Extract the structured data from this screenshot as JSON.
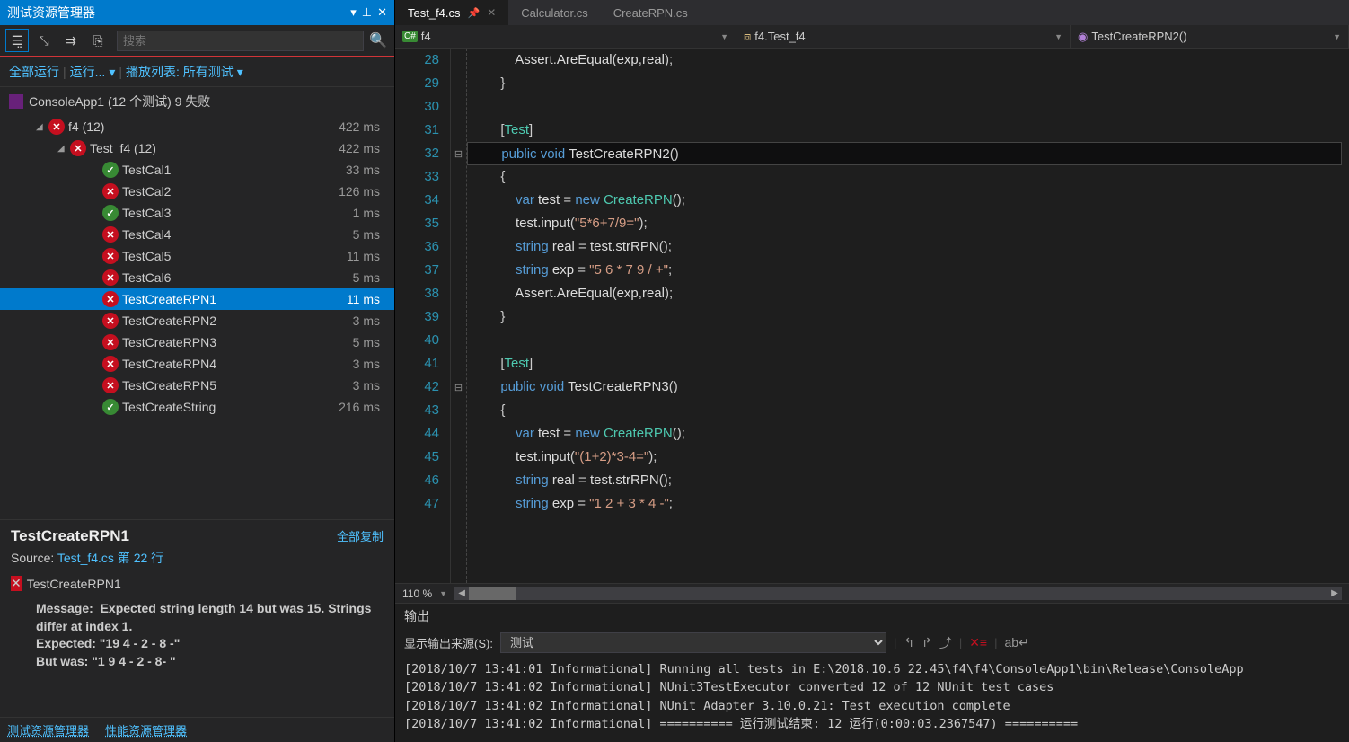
{
  "test_explorer": {
    "title": "测试资源管理器",
    "search_placeholder": "搜索",
    "run_all": "全部运行",
    "run": "运行...",
    "playlist": "播放列表: 所有测试",
    "summary": "ConsoleApp1 (12 个测试) 9 失败",
    "rows": [
      {
        "indent": 40,
        "chevron": "◢",
        "status": "fail",
        "label": "f4 (12)",
        "duration": "422 ms"
      },
      {
        "indent": 64,
        "chevron": "◢",
        "status": "fail",
        "label": "Test_f4 (12)",
        "duration": "422 ms"
      },
      {
        "indent": 100,
        "chevron": "",
        "status": "pass",
        "label": "TestCal1",
        "duration": "33 ms"
      },
      {
        "indent": 100,
        "chevron": "",
        "status": "fail",
        "label": "TestCal2",
        "duration": "126 ms"
      },
      {
        "indent": 100,
        "chevron": "",
        "status": "pass",
        "label": "TestCal3",
        "duration": "1 ms"
      },
      {
        "indent": 100,
        "chevron": "",
        "status": "fail",
        "label": "TestCal4",
        "duration": "5 ms"
      },
      {
        "indent": 100,
        "chevron": "",
        "status": "fail",
        "label": "TestCal5",
        "duration": "11 ms"
      },
      {
        "indent": 100,
        "chevron": "",
        "status": "fail",
        "label": "TestCal6",
        "duration": "5 ms"
      },
      {
        "indent": 100,
        "chevron": "",
        "status": "fail",
        "label": "TestCreateRPN1",
        "duration": "11 ms",
        "selected": true
      },
      {
        "indent": 100,
        "chevron": "",
        "status": "fail",
        "label": "TestCreateRPN2",
        "duration": "3 ms"
      },
      {
        "indent": 100,
        "chevron": "",
        "status": "fail",
        "label": "TestCreateRPN3",
        "duration": "5 ms"
      },
      {
        "indent": 100,
        "chevron": "",
        "status": "fail",
        "label": "TestCreateRPN4",
        "duration": "3 ms"
      },
      {
        "indent": 100,
        "chevron": "",
        "status": "fail",
        "label": "TestCreateRPN5",
        "duration": "3 ms"
      },
      {
        "indent": 100,
        "chevron": "",
        "status": "pass",
        "label": "TestCreateString",
        "duration": "216 ms"
      }
    ],
    "detail": {
      "name": "TestCreateRPN1",
      "copy_all": "全部复制",
      "source_label": "Source:",
      "source_link": "Test_f4.cs 第 22 行",
      "fail_name": "TestCreateRPN1",
      "msg_label": "Message:",
      "msg_body": "Expected string length 14 but was 15. Strings differ at index 1.\n  Expected: \"19 4 - 2 - 8 -\"\n  But was:  \"1 9 4 - 2 - 8- \""
    },
    "bottom_tabs": [
      "测试资源管理器",
      "性能资源管理器"
    ]
  },
  "editor": {
    "tabs": [
      {
        "label": "Test_f4.cs",
        "active": true,
        "pinned": true
      },
      {
        "label": "Calculator.cs",
        "active": false
      },
      {
        "label": "CreateRPN.cs",
        "active": false
      }
    ],
    "breadcrumb": {
      "seg1": "f4",
      "seg2": "f4.Test_f4",
      "seg3": "TestCreateRPN2()"
    },
    "zoom": "110 %",
    "lines": [
      {
        "n": 28,
        "html": "            <span class='id'>Assert</span>.<span class='id'>AreEqual</span>(<span class='id'>exp</span>,<span class='id'>real</span>);"
      },
      {
        "n": 29,
        "html": "        }"
      },
      {
        "n": 30,
        "html": ""
      },
      {
        "n": 31,
        "html": "        [<span class='attr'>Test</span>]"
      },
      {
        "n": 32,
        "html": "        <span class='kw'>public</span> <span class='kw'>void</span> <span class='id'>TestCreateRPN2</span>()",
        "hl": true,
        "fold": "⊟"
      },
      {
        "n": 33,
        "html": "        {"
      },
      {
        "n": 34,
        "html": "            <span class='kw'>var</span> <span class='id'>test</span> = <span class='kw'>new</span> <span class='type'>CreateRPN</span>();"
      },
      {
        "n": 35,
        "html": "            <span class='id'>test</span>.<span class='id'>input</span>(<span class='str'>\"5*6+7/9=\"</span>);"
      },
      {
        "n": 36,
        "html": "            <span class='kw'>string</span> <span class='id'>real</span> = <span class='id'>test</span>.<span class='id'>strRPN</span>();"
      },
      {
        "n": 37,
        "html": "            <span class='kw'>string</span> <span class='id'>exp</span> = <span class='str'>\"5 6 * 7 9 / +\"</span>;"
      },
      {
        "n": 38,
        "html": "            <span class='id'>Assert</span>.<span class='id'>AreEqual</span>(<span class='id'>exp</span>,<span class='id'>real</span>);"
      },
      {
        "n": 39,
        "html": "        }"
      },
      {
        "n": 40,
        "html": ""
      },
      {
        "n": 41,
        "html": "        [<span class='attr'>Test</span>]"
      },
      {
        "n": 42,
        "html": "        <span class='kw'>public</span> <span class='kw'>void</span> <span class='id'>TestCreateRPN3</span>()",
        "fold": "⊟"
      },
      {
        "n": 43,
        "html": "        {"
      },
      {
        "n": 44,
        "html": "            <span class='kw'>var</span> <span class='id'>test</span> = <span class='kw'>new</span> <span class='type'>CreateRPN</span>();"
      },
      {
        "n": 45,
        "html": "            <span class='id'>test</span>.<span class='id'>input</span>(<span class='str'>\"(1+2)*3-4=\"</span>);"
      },
      {
        "n": 46,
        "html": "            <span class='kw'>string</span> <span class='id'>real</span> = <span class='id'>test</span>.<span class='id'>strRPN</span>();"
      },
      {
        "n": 47,
        "html": "            <span class='kw'>string</span> <span class='id'>exp</span> = <span class='str'>\"1 2 + 3 * 4 -\"</span>;"
      }
    ]
  },
  "output": {
    "title": "输出",
    "source_label": "显示输出来源(S):",
    "source_value": "测试",
    "lines": [
      "[2018/10/7 13:41:01 Informational] Running all tests in E:\\2018.10.6 22.45\\f4\\f4\\ConsoleApp1\\bin\\Release\\ConsoleApp",
      "[2018/10/7 13:41:02 Informational] NUnit3TestExecutor converted 12 of 12 NUnit test cases",
      "[2018/10/7 13:41:02 Informational] NUnit Adapter 3.10.0.21: Test execution complete",
      "[2018/10/7 13:41:02 Informational] ========== 运行测试结束: 12 运行(0:00:03.2367547) =========="
    ]
  }
}
